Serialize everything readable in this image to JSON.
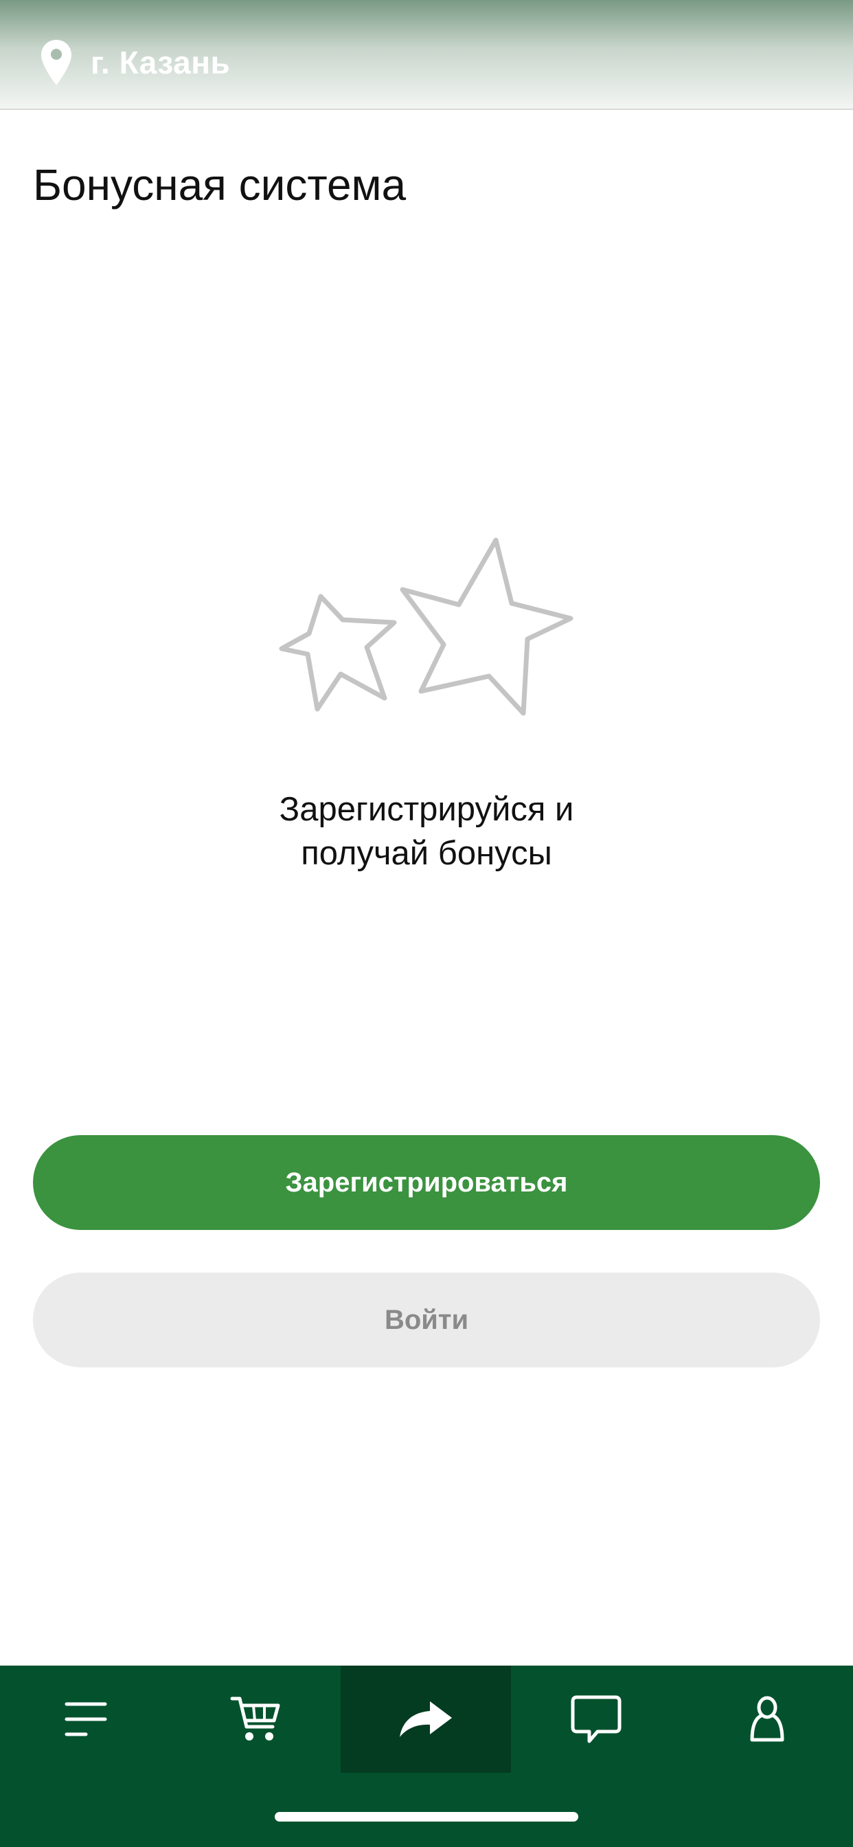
{
  "header": {
    "city": "г. Казань",
    "location_icon": "map-pin-icon"
  },
  "page": {
    "title": "Бонусная система",
    "illustration_icon": "stars-icon",
    "promo_line1": "Зарегистрируйся и",
    "promo_line2": "получай бонусы"
  },
  "buttons": {
    "register_label": "Зарегистрироваться",
    "login_label": "Войти"
  },
  "tabbar": {
    "items": [
      {
        "icon": "menu-icon",
        "active": false
      },
      {
        "icon": "cart-icon",
        "active": false
      },
      {
        "icon": "share-arrow-icon",
        "active": true
      },
      {
        "icon": "chat-icon",
        "active": false
      },
      {
        "icon": "profile-icon",
        "active": false
      }
    ]
  },
  "colors": {
    "accent_green": "#3b923f",
    "tabbar_bg": "#03522d",
    "tabbar_active_bg": "#033c21",
    "secondary_button_bg": "#ecebeb",
    "secondary_button_text": "#8a8a8a",
    "star_outline": "#c4c4c4"
  }
}
